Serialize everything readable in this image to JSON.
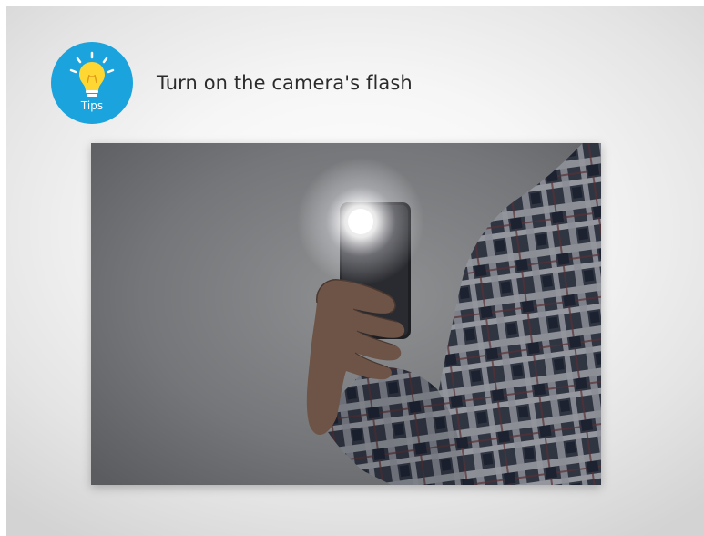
{
  "tips_badge": {
    "label": "Tips",
    "icon": "lightbulb-icon",
    "color": "#1aa3dc",
    "bulb_color": "#ffd733"
  },
  "tip": {
    "text": "Turn on the camera's flash"
  },
  "photo": {
    "subject": "person in plaid shirt holding smartphone with flash on",
    "flash_color": "#ffffff"
  }
}
